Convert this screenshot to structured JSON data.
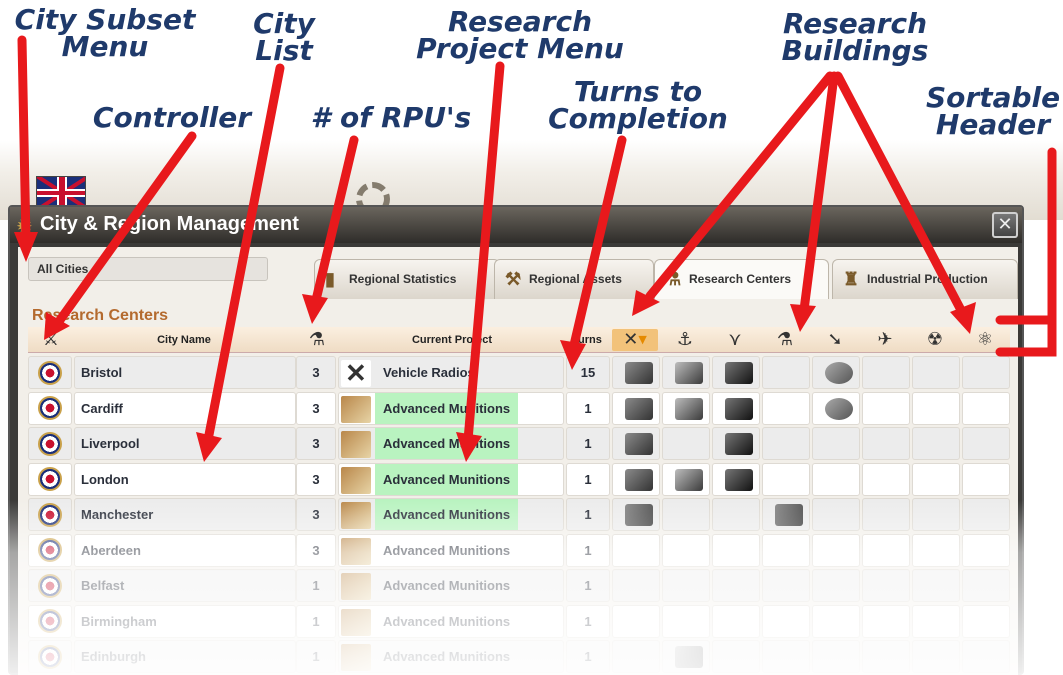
{
  "annotations": {
    "city_subset_menu": [
      "City Subset",
      "Menu"
    ],
    "city_list": [
      "City",
      "List"
    ],
    "research_project_menu": [
      "Research",
      "Project Menu"
    ],
    "research_buildings": [
      "Research",
      "Buildings"
    ],
    "controller": "Controller",
    "num_rpus": "# of RPU's",
    "turns_to_completion": [
      "Turns to",
      "Completion"
    ],
    "sortable_header": [
      "Sortable",
      "Header"
    ]
  },
  "window": {
    "title": "City & Region Management",
    "close_label": "✕"
  },
  "city_subset": {
    "selected": "All Cities"
  },
  "tabs": [
    {
      "label": "Regional Statistics",
      "icon": "regional-statistics-icon",
      "active": false
    },
    {
      "label": "Regional Assets",
      "icon": "regional-assets-icon",
      "active": false
    },
    {
      "label": "Research Centers",
      "icon": "research-centers-icon",
      "active": true
    },
    {
      "label": "Industrial Production",
      "icon": "industrial-production-icon",
      "active": false
    }
  ],
  "section_title": "Research Centers",
  "table": {
    "headers": {
      "controller_icon": "controller-icon",
      "city_name": "City Name",
      "rpu_icon": "rpu-flask-icon",
      "current_project": "Current Project",
      "turns": "Turns"
    },
    "building_headers": [
      {
        "name": "weapons-icon",
        "glyph": "✕",
        "sorted": true
      },
      {
        "name": "naval-anchor-icon",
        "glyph": "⚓",
        "sorted": false
      },
      {
        "name": "air-wings-icon",
        "glyph": "⋎",
        "sorted": false
      },
      {
        "name": "lab-flask-icon",
        "glyph": "⚗",
        "sorted": false
      },
      {
        "name": "rocket-icon",
        "glyph": "➘",
        "sorted": false
      },
      {
        "name": "jet-icon",
        "glyph": "✈",
        "sorted": false
      },
      {
        "name": "nuclear-icon",
        "glyph": "☢",
        "sorted": false
      },
      {
        "name": "atom-icon",
        "glyph": "⚛",
        "sorted": false
      }
    ],
    "rows": [
      {
        "city": "Bristol",
        "rpu": "3",
        "project": "Vehicle Radios",
        "project_thumb": "crossed-tools",
        "project_active": false,
        "turns": "15",
        "buildings": [
          1,
          1,
          1,
          0,
          1,
          0,
          0,
          0
        ]
      },
      {
        "city": "Cardiff",
        "rpu": "3",
        "project": "Advanced Munitions",
        "project_thumb": "factory",
        "project_active": true,
        "turns": "1",
        "buildings": [
          1,
          1,
          1,
          0,
          1,
          0,
          0,
          0
        ]
      },
      {
        "city": "Liverpool",
        "rpu": "3",
        "project": "Advanced Munitions",
        "project_thumb": "factory",
        "project_active": true,
        "turns": "1",
        "buildings": [
          1,
          0,
          1,
          0,
          0,
          0,
          0,
          0
        ]
      },
      {
        "city": "London",
        "rpu": "3",
        "project": "Advanced Munitions",
        "project_thumb": "factory",
        "project_active": true,
        "turns": "1",
        "buildings": [
          1,
          1,
          1,
          0,
          0,
          0,
          0,
          0
        ]
      },
      {
        "city": "Manchester",
        "rpu": "3",
        "project": "Advanced Munitions",
        "project_thumb": "factory",
        "project_active": true,
        "turns": "1",
        "buildings": [
          1,
          0,
          0,
          1,
          0,
          0,
          0,
          0
        ]
      },
      {
        "city": "Aberdeen",
        "rpu": "3",
        "project": "Advanced Munitions",
        "project_thumb": "factory",
        "project_active": false,
        "turns": "1",
        "buildings": [
          0,
          0,
          0,
          0,
          0,
          0,
          0,
          0
        ]
      },
      {
        "city": "Belfast",
        "rpu": "1",
        "project": "Advanced Munitions",
        "project_thumb": "factory",
        "project_active": false,
        "turns": "1",
        "buildings": [
          0,
          0,
          0,
          0,
          0,
          0,
          0,
          0
        ]
      },
      {
        "city": "Birmingham",
        "rpu": "1",
        "project": "Advanced Munitions",
        "project_thumb": "factory",
        "project_active": false,
        "turns": "1",
        "buildings": [
          0,
          0,
          0,
          0,
          0,
          0,
          0,
          0
        ]
      },
      {
        "city": "Edinburgh",
        "rpu": "1",
        "project": "Advanced Munitions",
        "project_thumb": "factory",
        "project_active": false,
        "turns": "1",
        "buildings": [
          0,
          1,
          0,
          0,
          0,
          0,
          0,
          0
        ]
      }
    ]
  },
  "colors": {
    "annotation_text": "#1f3a6b",
    "arrow": "#e8191c",
    "active_project": "#b9f3c0",
    "section_title": "#b46a2e",
    "sorted_header": "#f2c27a"
  }
}
